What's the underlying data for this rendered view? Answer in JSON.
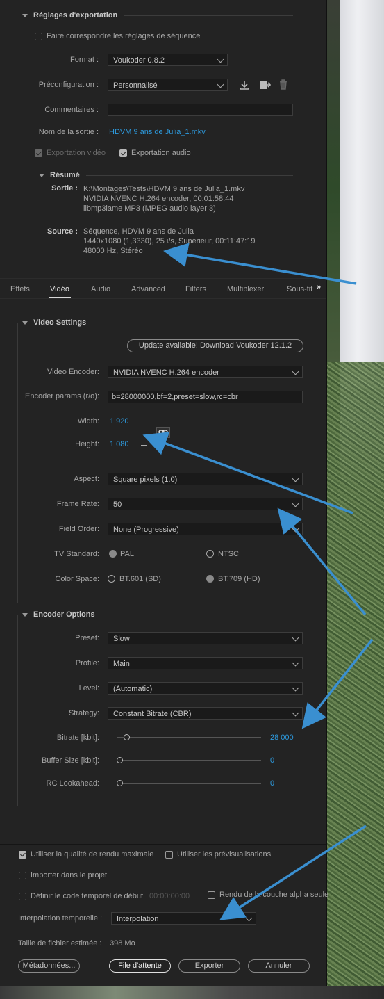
{
  "export_settings": {
    "title": "Réglages d'exportation",
    "match_sequence_label": "Faire correspondre les réglages de séquence",
    "format_label": "Format :",
    "format_value": "Voukoder 0.8.2",
    "preset_label": "Préconfiguration :",
    "preset_value": "Personnalisé",
    "comments_label": "Commentaires :",
    "comments_value": "",
    "output_name_label": "Nom de la sortie :",
    "output_name_value": "HDVM 9 ans de Julia_1.mkv",
    "export_video_label": "Exportation vidéo",
    "export_audio_label": "Exportation audio"
  },
  "summary": {
    "title": "Résumé",
    "output_label": "Sortie :",
    "output_lines": [
      "K:\\Montages\\Tests\\HDVM 9 ans de Julia_1.mkv",
      "NVIDIA NVENC H.264 encoder, 00:01:58:44",
      "libmp3lame MP3 (MPEG audio layer 3)"
    ],
    "source_label": "Source :",
    "source_lines": [
      "Séquence, HDVM 9 ans de Julia",
      "1440x1080 (1,3330), 25  i/s, Supérieur, 00:11:47:19",
      "48000 Hz, Stéréo"
    ]
  },
  "tabs": [
    "Effets",
    "Vidéo",
    "Audio",
    "Advanced",
    "Filters",
    "Multiplexer",
    "Sous-tit"
  ],
  "video_settings": {
    "title": "Video Settings",
    "update_button": "Update available! Download Voukoder 12.1.2",
    "encoder_label": "Video Encoder:",
    "encoder_value": "NVIDIA NVENC H.264 encoder",
    "params_label": "Encoder params (r/o):",
    "params_value": "b=28000000,bf=2,preset=slow,rc=cbr",
    "width_label": "Width:",
    "width_value": "1 920",
    "height_label": "Height:",
    "height_value": "1 080",
    "aspect_label": "Aspect:",
    "aspect_value": "Square pixels (1.0)",
    "framerate_label": "Frame Rate:",
    "framerate_value": "50",
    "fieldorder_label": "Field Order:",
    "fieldorder_value": "None (Progressive)",
    "tvstandard_label": "TV Standard:",
    "tv_pal": "PAL",
    "tv_ntsc": "NTSC",
    "colorspace_label": "Color Space:",
    "cs_601": "BT.601 (SD)",
    "cs_709": "BT.709 (HD)"
  },
  "encoder_options": {
    "title": "Encoder Options",
    "preset_label": "Preset:",
    "preset_value": "Slow",
    "profile_label": "Profile:",
    "profile_value": "Main",
    "level_label": "Level:",
    "level_value": "(Automatic)",
    "strategy_label": "Strategy:",
    "strategy_value": "Constant Bitrate (CBR)",
    "bitrate_label": "Bitrate [kbit]:",
    "bitrate_value": "28 000",
    "buffer_label": "Buffer Size [kbit]:",
    "buffer_value": "0",
    "lookahead_label": "RC Lookahead:",
    "lookahead_value": "0"
  },
  "footer": {
    "max_quality": "Utiliser la qualité de rendu maximale",
    "use_previews": "Utiliser les prévisualisations",
    "import_project": "Importer dans le projet",
    "set_timecode": "Définir le code temporel de début",
    "timecode_value": "00:00:00:00",
    "alpha_only": "Rendu de la couche alpha seule",
    "interp_label": "Interpolation temporelle :",
    "interp_value": "Interpolation",
    "filesize_label": "Taille de fichier estimée :",
    "filesize_value": "398 Mo",
    "metadata_button": "Métadonnées...",
    "queue_button": "File d'attente",
    "export_button": "Exporter",
    "cancel_button": "Annuler"
  },
  "colors": {
    "accent": "#2d9bdf",
    "arrow": "#3a8fd0",
    "panel": "#232323"
  }
}
